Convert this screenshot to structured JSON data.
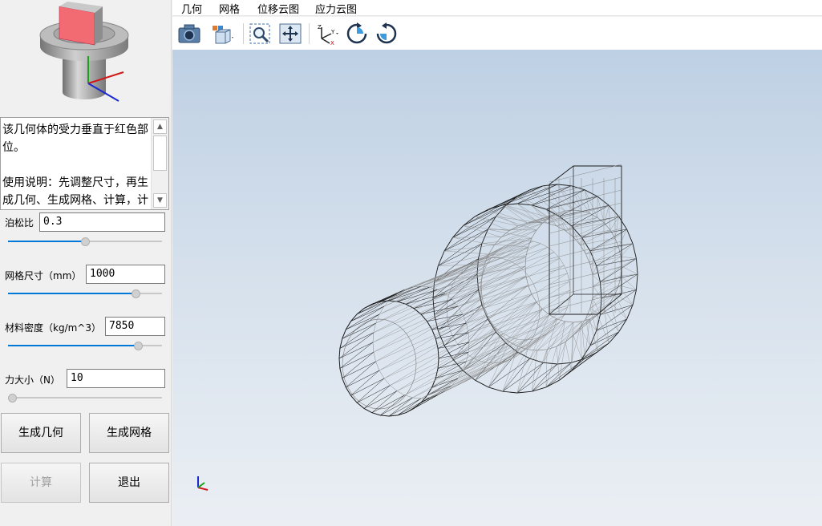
{
  "menu": [
    "几何",
    "网格",
    "位移云图",
    "应力云图"
  ],
  "toolbar": {
    "icons": [
      "camera-icon",
      "view-cube-icon",
      "zoom-window-icon",
      "fit-all-icon",
      "axis-xyz-icon",
      "rotate-cw-icon",
      "rotate-ccw-icon"
    ]
  },
  "description": "该几何体的受力垂直于红色部位。\n\n使用说明：先调整尺寸，再生成几何、生成网格、计算，计算完成后可在右方查看结果。",
  "params": {
    "poisson": {
      "label": "泊松比",
      "value": "0.3",
      "level": 0.5
    },
    "mesh_size": {
      "label": "网格尺寸（mm）",
      "value": "1000",
      "level": 0.85
    },
    "density": {
      "label": "材料密度（kg/m^3）",
      "value": "7850",
      "level": 0.87
    },
    "force": {
      "label": "力大小（N）",
      "value": "10",
      "level": 0.0
    }
  },
  "buttons": {
    "gen_geometry": "生成几何",
    "gen_mesh": "生成网格",
    "compute": "计算",
    "exit": "退出"
  },
  "colors": {
    "accent": "#0078d7",
    "loaded_face": "#f26b72",
    "viewport_top": "#bed0e4",
    "viewport_bottom": "#ebeff4"
  }
}
